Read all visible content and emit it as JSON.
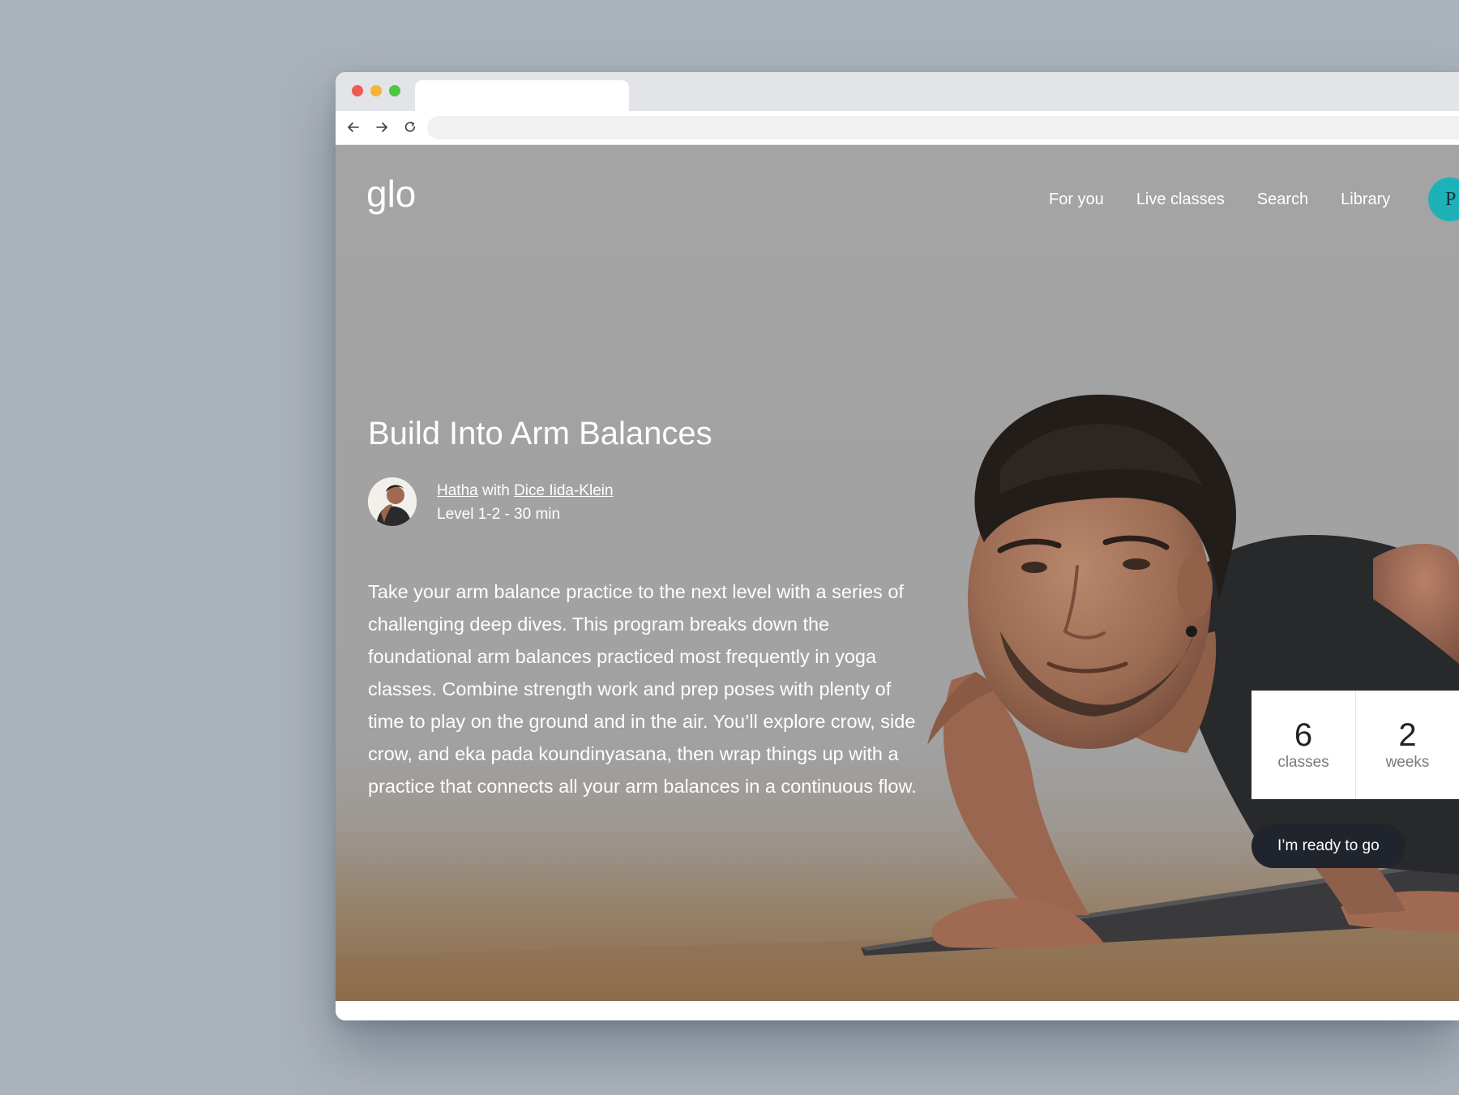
{
  "colors": {
    "desktop_background": "#aab2bb",
    "hero_background": "#a3a3a3",
    "profile_avatar": "#1db2b8",
    "cta_background": "#20242c"
  },
  "site": {
    "logo_text": "glo",
    "nav": {
      "for_you": "For you",
      "live_classes": "Live classes",
      "search": "Search",
      "library": "Library"
    },
    "profile_initial": "P"
  },
  "program": {
    "title": "Build Into Arm Balances",
    "style": "Hatha",
    "with": "with",
    "teacher": "Dice Iida-Klein",
    "level_duration": "Level 1-2 - 30 min",
    "description": "Take your arm balance practice to the next level with a series of challenging deep dives. This program breaks down the foundational arm balances practiced most frequently in yoga classes. Combine strength work and prep poses with plenty of time to play on the ground and in the air. You’ll explore crow, side crow, and eka pada koundinyasana, then wrap things up with a practice that connects all your arm balances in a continuous flow.",
    "stats": {
      "classes_value": "6",
      "classes_label": "classes",
      "weeks_value": "2",
      "weeks_label": "weeks"
    },
    "cta_label": "I’m ready to go"
  },
  "icons": {
    "back": "arrow-left-icon",
    "forward": "arrow-right-icon",
    "reload": "reload-icon"
  }
}
